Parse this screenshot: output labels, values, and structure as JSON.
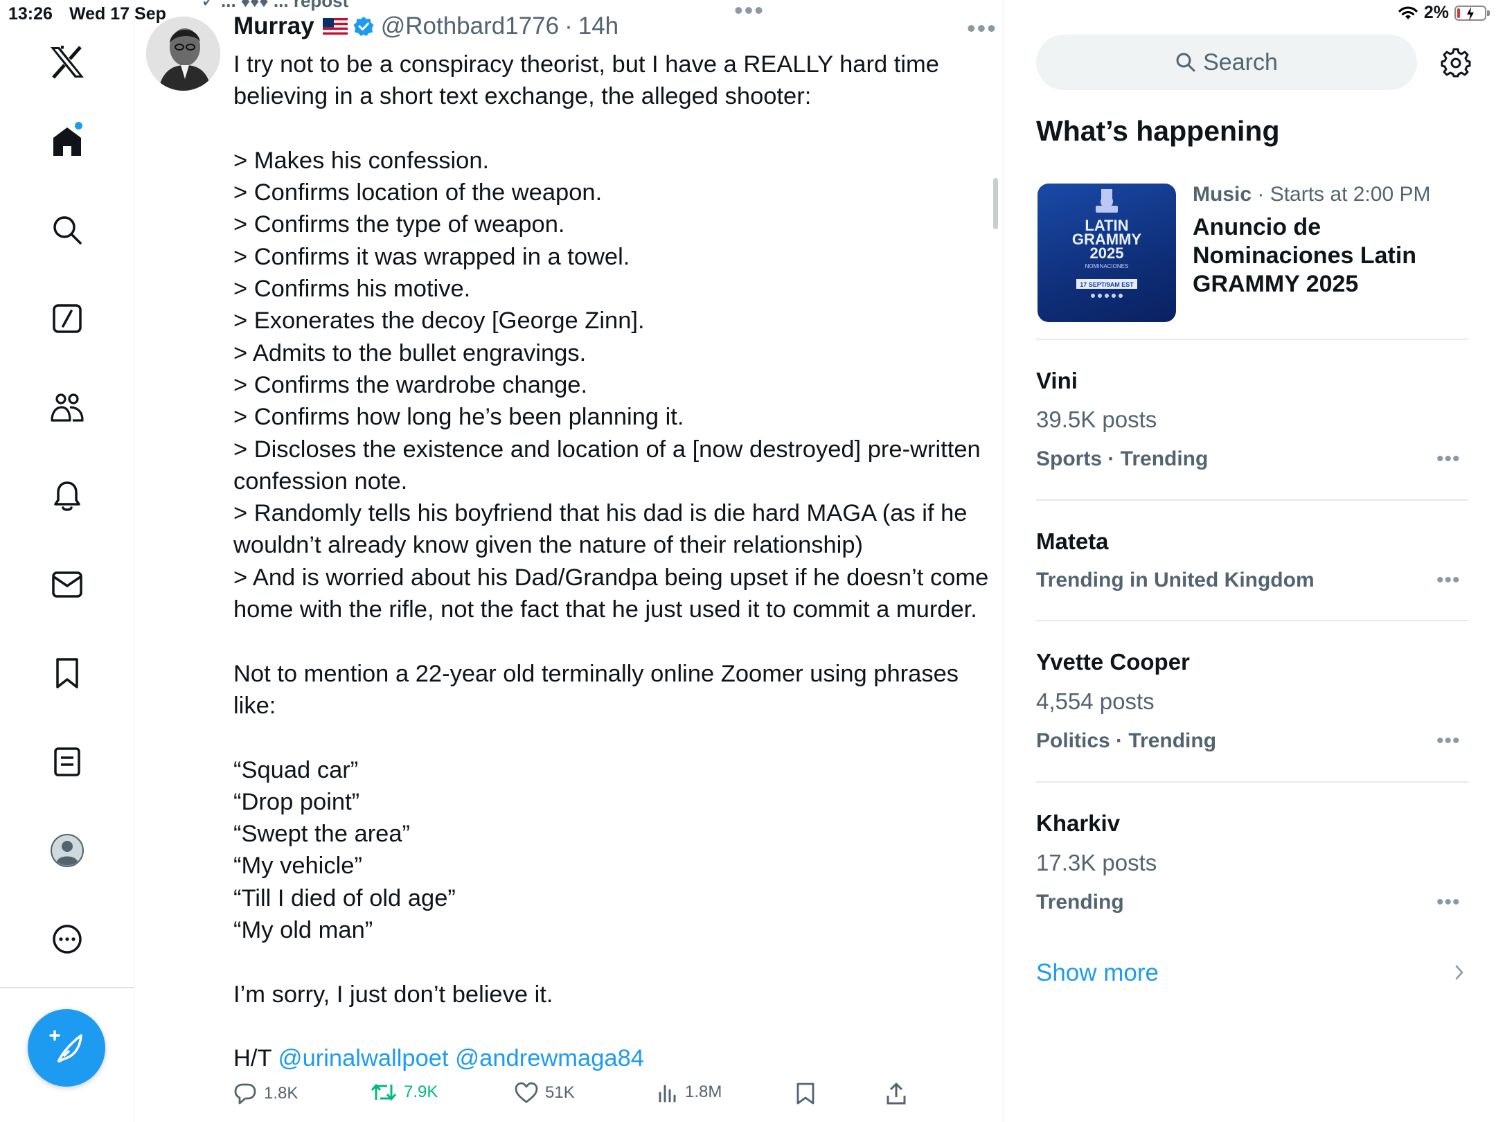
{
  "status_bar": {
    "time": "13:26",
    "date": "Wed 17 Sep",
    "battery": "2%",
    "battery_level": 0.02
  },
  "repost_banner": "✓ ...  ♦♦♦ ...  repost",
  "tweet": {
    "name": "Murray",
    "handle": "@Rothbard1776",
    "time": "14h",
    "lines": [
      "I try not to be a conspiracy theorist, but I have a REALLY hard time",
      "believing in a short text exchange, the alleged shooter:",
      "",
      "> Makes his confession.",
      "> Confirms location of the weapon.",
      "> Confirms the type of weapon.",
      "> Confirms it was wrapped in a towel.",
      "> Confirms his motive.",
      "> Exonerates the decoy [George Zinn].",
      "> Admits to the bullet engravings.",
      "> Confirms the wardrobe change.",
      "> Confirms how long he’s been planning it.",
      "> Discloses the existence and location of a [now destroyed] pre-written",
      "confession note.",
      "> Randomly tells his boyfriend that his dad is die hard MAGA (as if he",
      "wouldn’t already know given the nature of their relationship)",
      "> And is worried about his Dad/Grandpa being upset if he doesn’t come",
      "home with the rifle, not the fact that he just used it to commit a murder.",
      "",
      "Not to mention a 22-year old terminally online Zoomer using phrases",
      "like:",
      "",
      "“Squad car”",
      "“Drop point”",
      "“Swept the area”",
      "“My vehicle”",
      "“Till I died of old age”",
      "“My old man”",
      "",
      "I’m sorry, I just don’t believe it."
    ],
    "ht_prefix": "H/T ",
    "mention1": "@urinalwallpoet",
    "mention2": "@andrewmaga84",
    "stats": {
      "replies": "1.8K",
      "reposts": "7.9K",
      "likes": "51K",
      "views": "1.8M"
    }
  },
  "sidebar": {
    "search_placeholder": "Search",
    "section_title": "What’s happening",
    "featured": {
      "category": "Music",
      "meta": " · Starts at 2:00 PM",
      "title": "Anuncio de Nominaciones Latin GRAMMY 2025",
      "image_text": {
        "line1": "LATIN",
        "line2": "GRAMMY",
        "line3": "2025",
        "line4": "NOMINACIONES",
        "date": "17 SEPT/9AM EST"
      }
    },
    "trends": [
      {
        "name": "Vini",
        "posts": "39.5K posts",
        "meta": "Sports · Trending"
      },
      {
        "name": "Mateta",
        "posts": "",
        "meta": "Trending in United Kingdom"
      },
      {
        "name": "Yvette Cooper",
        "posts": "4,554 posts",
        "meta": "Politics · Trending"
      },
      {
        "name": "Kharkiv",
        "posts": "17.3K posts",
        "meta": "Trending"
      }
    ],
    "show_more": "Show more"
  },
  "colors": {
    "accent": "#1d9bf0",
    "repost_green": "#00ba7c",
    "secondary_text": "#536471"
  }
}
